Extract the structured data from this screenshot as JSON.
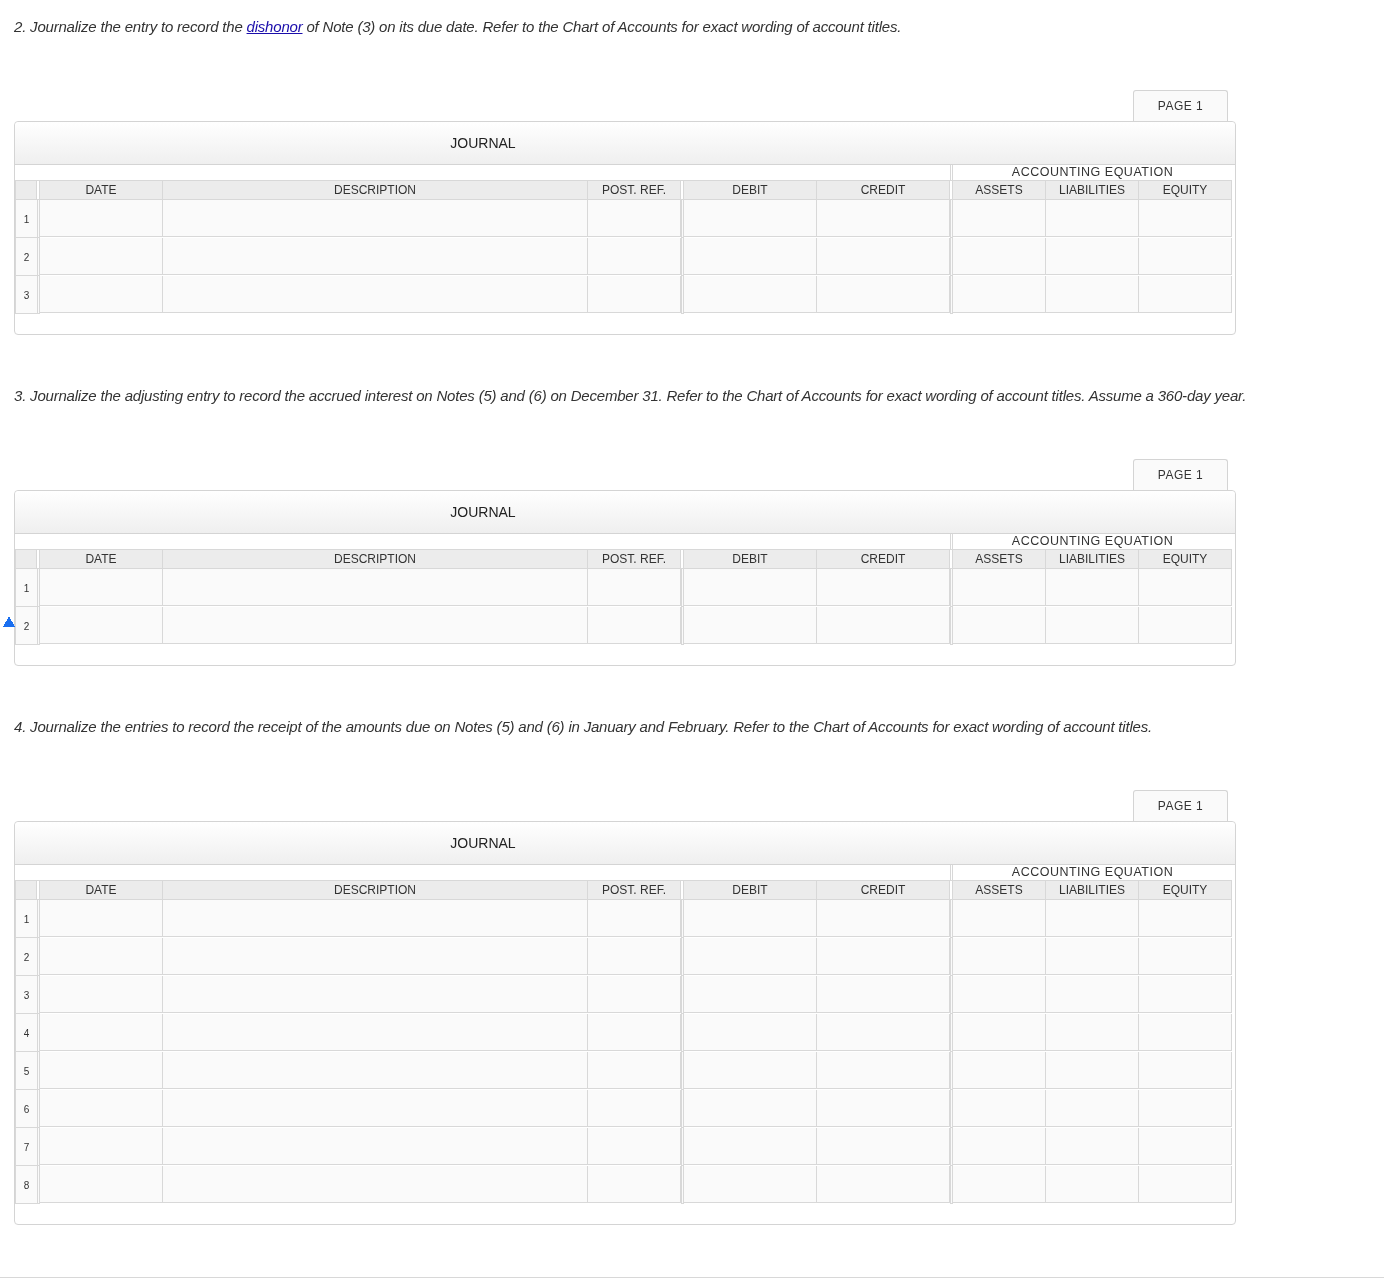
{
  "sections": [
    {
      "instruction": {
        "before": "2. Journalize the entry to record the ",
        "link": "dishonor",
        "after": " of Note (3) on its due date. Refer to the Chart of Accounts for exact wording of account titles."
      },
      "journal": {
        "page_label": "PAGE 1",
        "title": "JOURNAL",
        "equation_label": "ACCOUNTING EQUATION",
        "columns": [
          "DATE",
          "DESCRIPTION",
          "POST. REF.",
          "DEBIT",
          "CREDIT",
          "ASSETS",
          "LIABILITIES",
          "EQUITY"
        ],
        "rows": [
          {
            "number": "1",
            "flagged": false
          },
          {
            "number": "2",
            "flagged": false
          },
          {
            "number": "3",
            "flagged": false
          }
        ]
      }
    },
    {
      "instruction": {
        "before": "3. Journalize the adjusting entry to record the accrued interest on Notes (5) and (6) on December 31. Refer to the Chart of Accounts for exact wording of account titles. Assume a 360-day year."
      },
      "journal": {
        "page_label": "PAGE 1",
        "title": "JOURNAL",
        "equation_label": "ACCOUNTING EQUATION",
        "columns": [
          "DATE",
          "DESCRIPTION",
          "POST. REF.",
          "DEBIT",
          "CREDIT",
          "ASSETS",
          "LIABILITIES",
          "EQUITY"
        ],
        "rows": [
          {
            "number": "1",
            "flagged": false
          },
          {
            "number": "2",
            "flagged": true
          }
        ]
      }
    },
    {
      "instruction": {
        "before": "4. Journalize the entries to record the receipt of the amounts due on Notes (5) and (6) in January and February. Refer to the Chart of Accounts for exact wording of account titles."
      },
      "journal": {
        "page_label": "PAGE 1",
        "title": "JOURNAL",
        "equation_label": "ACCOUNTING EQUATION",
        "columns": [
          "DATE",
          "DESCRIPTION",
          "POST. REF.",
          "DEBIT",
          "CREDIT",
          "ASSETS",
          "LIABILITIES",
          "EQUITY"
        ],
        "rows": [
          {
            "number": "1",
            "flagged": false
          },
          {
            "number": "2",
            "flagged": false
          },
          {
            "number": "3",
            "flagged": false
          },
          {
            "number": "4",
            "flagged": false
          },
          {
            "number": "5",
            "flagged": false
          },
          {
            "number": "6",
            "flagged": false
          },
          {
            "number": "7",
            "flagged": false
          },
          {
            "number": "8",
            "flagged": false
          }
        ]
      }
    }
  ]
}
